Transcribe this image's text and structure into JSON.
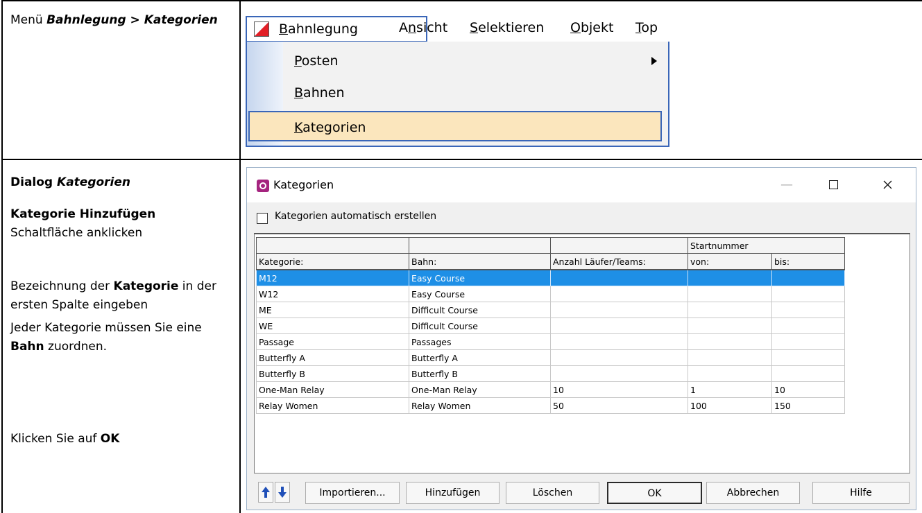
{
  "left": {
    "menu_prefix": "Menü ",
    "menu_path": "Bahnlegung > Kategorien",
    "dialog_label": "Dialog ",
    "dialog_name": "Kategorien",
    "step1_bold": "Kategorie Hinzufügen",
    "step1_rest": "Schaltfläche anklicken",
    "step2_a": "Bezeichnung der ",
    "step2_bold": "Kategorie",
    "step2_b": " in der ersten Spalte eingeben",
    "step3_a": "Jeder Kategorie müssen Sie eine ",
    "step3_bold": "Bahn",
    "step3_b": " zuordnen.",
    "step4_a": "Klicken Sie auf ",
    "step4_bold": "OK"
  },
  "menu": {
    "items_top": [
      {
        "text": "Bahnlegung",
        "mnemonic": "B"
      },
      {
        "text": "Ansicht",
        "mnemonic": "n"
      },
      {
        "text": "Selektieren",
        "mnemonic": "S"
      },
      {
        "text": "Objekt",
        "mnemonic": "O"
      },
      {
        "text": "Top",
        "mnemonic": "T"
      }
    ],
    "dropdown": [
      {
        "text": "Posten",
        "mnemonic": "P"
      },
      {
        "text": "Bahnen",
        "mnemonic": "B"
      },
      {
        "text": "Kategorien",
        "mnemonic": "K"
      }
    ]
  },
  "dialog": {
    "title": "Kategorien",
    "auto_checkbox_label": "Kategorien automatisch erstellen",
    "auto_checked": false,
    "group_header": "Startnummer",
    "columns": [
      "Kategorie:",
      "Bahn:",
      "Anzahl Läufer/Teams:",
      "von:",
      "bis:"
    ],
    "rows": [
      [
        "M12",
        "Easy Course",
        "",
        "",
        ""
      ],
      [
        "W12",
        "Easy Course",
        "",
        "",
        ""
      ],
      [
        "ME",
        "Difficult Course",
        "",
        "",
        ""
      ],
      [
        "WE",
        "Difficult Course",
        "",
        "",
        ""
      ],
      [
        "Passage",
        "Passages",
        "",
        "",
        ""
      ],
      [
        "Butterfly A",
        "Butterfly A",
        "",
        "",
        ""
      ],
      [
        "Butterfly B",
        "Butterfly B",
        "",
        "",
        ""
      ],
      [
        "One-Man Relay",
        "One-Man Relay",
        "10",
        "1",
        "10"
      ],
      [
        "Relay Women",
        "Relay Women",
        "50",
        "100",
        "150"
      ]
    ],
    "selected_row": 0,
    "buttons": {
      "import": "Importieren...",
      "add": "Hinzufügen",
      "delete": "Löschen",
      "ok": "OK",
      "cancel": "Abbrechen",
      "help": "Hilfe"
    },
    "colors": {
      "selection": "#1e8fe6",
      "arrow": "#1f4fb8",
      "icon": "#a5247f"
    }
  }
}
